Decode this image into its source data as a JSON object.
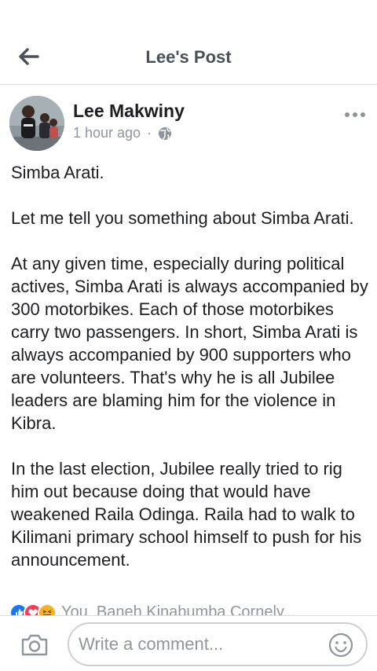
{
  "header": {
    "title": "Lee's Post",
    "back_icon": "arrow-left-icon"
  },
  "post": {
    "author": "Lee Makwiny",
    "time": "1 hour ago",
    "separator": "·",
    "privacy_icon": "globe-icon",
    "more_icon": "more-horizontal-icon",
    "paragraphs": [
      "Simba Arati.",
      "Let me tell you something about Simba Arati.",
      "At any given time, especially during political actives, Simba Arati is always accompanied by 300 motorbikes. Each of those motorbikes carry two passengers. In short, Simba Arati is always accompanied by 900 supporters who are volunteers. That's why he is all Jubilee leaders are blaming him for the violence in Kibra.",
      "In the last election, Jubilee really tried to rig him out because doing that would have weakened Raila Odinga. Raila had to walk to Kilimani primary school himself to push for his announcement."
    ]
  },
  "reactions": {
    "icons": [
      "like-reaction-icon",
      "love-reaction-icon",
      "haha-reaction-icon"
    ],
    "summary": "You, Baneh Kinabumba Cornely..."
  },
  "composer": {
    "camera_icon": "camera-icon",
    "placeholder": "Write a comment...",
    "value": "",
    "emoji_icon": "emoji-icon"
  },
  "colors": {
    "text": "#1c1e21",
    "secondary_text": "#90949c",
    "header_title": "#4b4f56",
    "divider": "#dadde1",
    "like_blue": "#1877f2",
    "love_red": "#f33e58",
    "haha_yellow": "#f7b125"
  }
}
